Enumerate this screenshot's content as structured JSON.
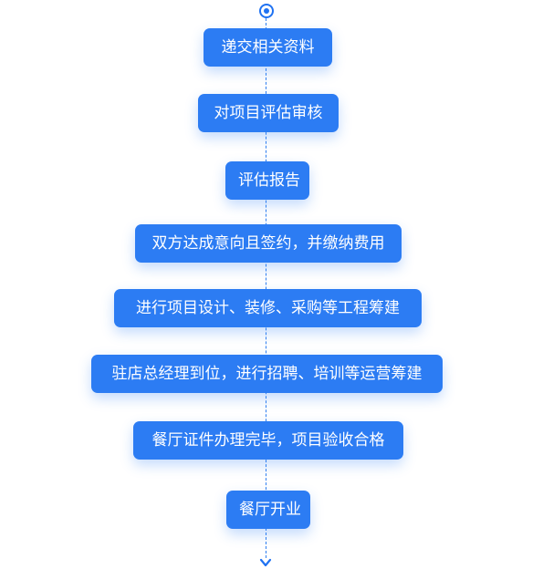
{
  "flow": {
    "steps": [
      "递交相关资料",
      "对项目评估审核",
      "评估报告",
      "双方达成意向且签约，并缴纳费用",
      "进行项目设计、装修、采购等工程筹建",
      "驻店总经理到位，进行招聘、培训等运营筹建",
      "餐厅证件办理完毕，项目验收合格",
      "餐厅开业"
    ],
    "colors": {
      "box": "#2c7cf3",
      "line": "#2f7ff0",
      "text": "#ffffff"
    },
    "icons": {
      "start": "start-dot-icon",
      "end": "chevron-down-icon"
    }
  }
}
